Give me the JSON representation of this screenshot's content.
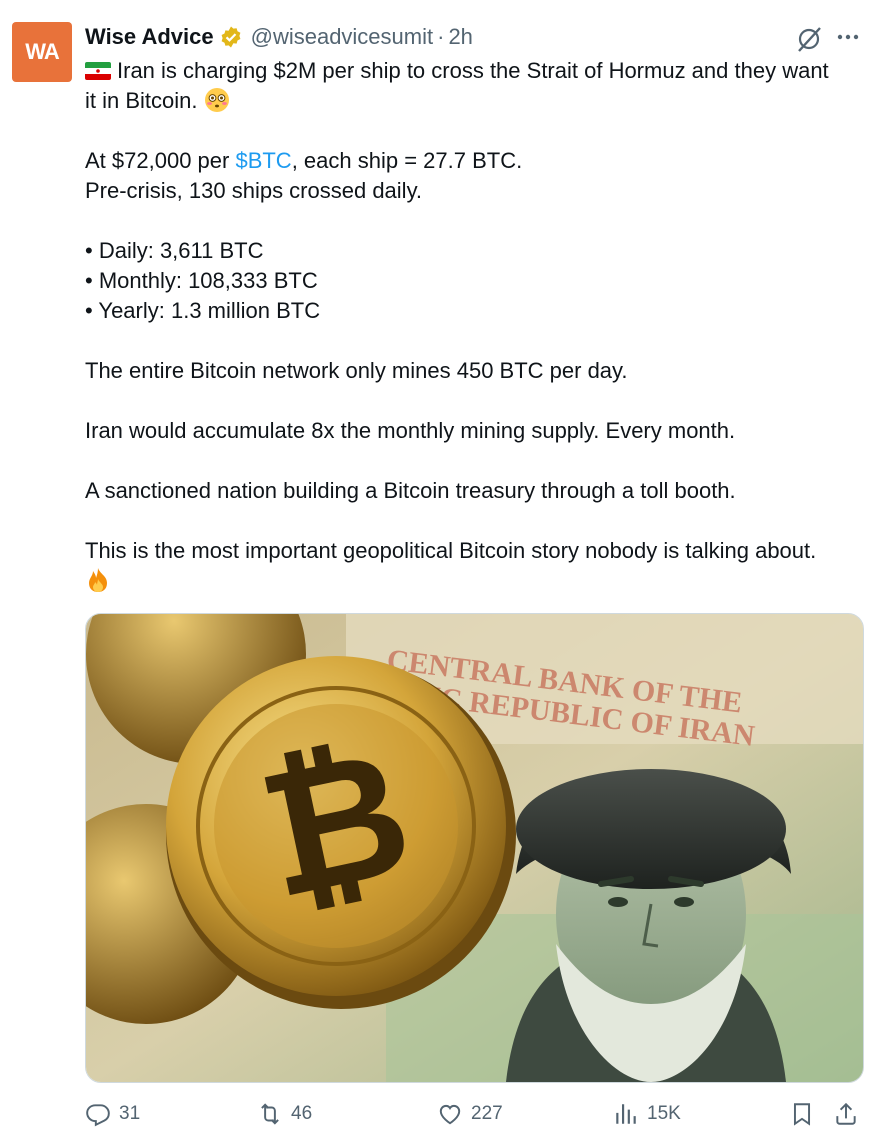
{
  "author": {
    "avatar_text": "WA",
    "name": "Wise Advice",
    "handle": "@wiseadvicesumit",
    "separator": "·",
    "time": "2h"
  },
  "post": {
    "line1": "Iran is charging $2M per ship to cross the Strait of Hormuz and they want it in Bitcoin.",
    "line2_pre": "At $72,000 per ",
    "line2_cashtag": "$BTC",
    "line2_post": ", each ship = 27.7 BTC.",
    "line3": "Pre-crisis, 130 ships crossed daily.",
    "bullets": [
      "• Daily: 3,611 BTC",
      "• Monthly: 108,333 BTC",
      "• Yearly: 1.3 million BTC"
    ],
    "para1": "The entire Bitcoin network only mines 450 BTC per day.",
    "para2": "Iran would accumulate 8x the monthly mining supply. Every month.",
    "para3": "A sanctioned nation building a Bitcoin treasury through a toll booth.",
    "para4": "This is the most important geopolitical Bitcoin story nobody is talking about."
  },
  "media": {
    "banknote_text_line1": "CENTRAL BANK OF THE",
    "banknote_text_line2": "AMIC REPUBLIC OF IRAN"
  },
  "actions": {
    "replies": "31",
    "reposts": "46",
    "likes": "227",
    "views": "15K"
  },
  "icons": [
    "verified-icon",
    "grok-icon",
    "more-icon",
    "iran-flag-icon",
    "flushed-emoji-icon",
    "fire-emoji-icon",
    "reply-icon",
    "repost-icon",
    "like-icon",
    "views-icon",
    "bookmark-icon",
    "share-icon"
  ],
  "colors": {
    "link": "#1d9bf0",
    "muted": "#536471",
    "avatar": "#e8723a",
    "verified": "#e2b719"
  }
}
